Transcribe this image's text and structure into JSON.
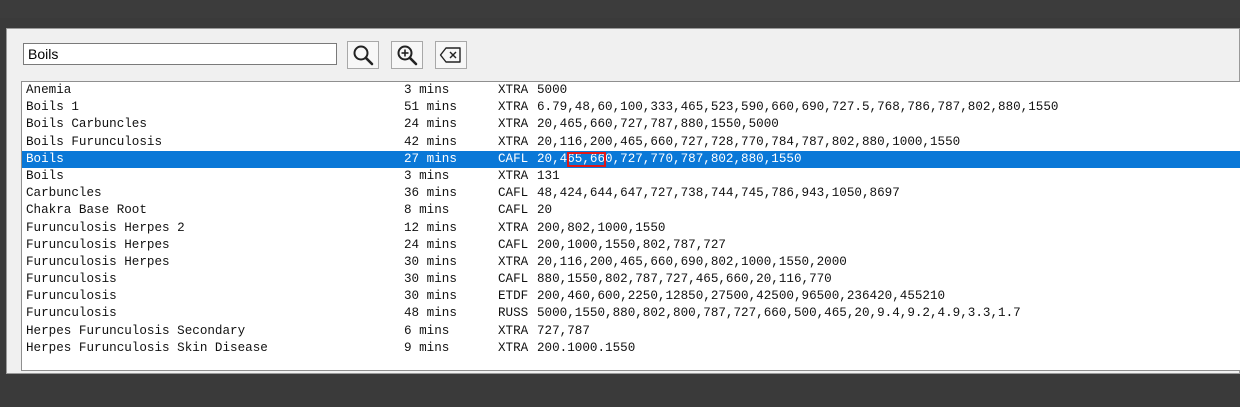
{
  "search": {
    "value": "Boils"
  },
  "buttons": {
    "search": "search-icon",
    "zoom_in": "zoom-in-icon",
    "clear": "clear-icon"
  },
  "rows": [
    {
      "name": "Anemia",
      "time": "3 mins",
      "code": "XTRA",
      "freq": "5000"
    },
    {
      "name": "Boils 1",
      "time": "51 mins",
      "code": "XTRA",
      "freq": "6.79,48,60,100,333,465,523,590,660,690,727.5,768,786,787,802,880,1550"
    },
    {
      "name": "Boils Carbuncles",
      "time": "24 mins",
      "code": "XTRA",
      "freq": "20,465,660,727,787,880,1550,5000"
    },
    {
      "name": "Boils Furunculosis",
      "time": "42 mins",
      "code": "XTRA",
      "freq": "20,116,200,465,660,727,728,770,784,787,802,880,1000,1550"
    },
    {
      "name": "Boils",
      "time": "27 mins",
      "code": "CAFL",
      "freq": "20,465,660,727,770,787,802,880,1550",
      "selected": true
    },
    {
      "name": "Boils",
      "time": "3 mins",
      "code": "XTRA",
      "freq": "131"
    },
    {
      "name": "Carbuncles",
      "time": "36 mins",
      "code": "CAFL",
      "freq": "48,424,644,647,727,738,744,745,786,943,1050,8697"
    },
    {
      "name": "Chakra Base Root",
      "time": "8 mins",
      "code": "CAFL",
      "freq": "20"
    },
    {
      "name": "Furunculosis Herpes 2",
      "time": "12 mins",
      "code": "XTRA",
      "freq": "200,802,1000,1550"
    },
    {
      "name": "Furunculosis Herpes",
      "time": "24 mins",
      "code": "CAFL",
      "freq": "200,1000,1550,802,787,727"
    },
    {
      "name": "Furunculosis Herpes",
      "time": "30 mins",
      "code": "XTRA",
      "freq": "20,116,200,465,660,690,802,1000,1550,2000"
    },
    {
      "name": "Furunculosis",
      "time": "30 mins",
      "code": "CAFL",
      "freq": "880,1550,802,787,727,465,660,20,116,770"
    },
    {
      "name": "Furunculosis",
      "time": "30 mins",
      "code": "ETDF",
      "freq": "200,460,600,2250,12850,27500,42500,96500,236420,455210"
    },
    {
      "name": "Furunculosis",
      "time": "48 mins",
      "code": "RUSS",
      "freq": "5000,1550,880,802,800,787,727,660,500,465,20,9.4,9.2,4.9,3.3,1.7"
    },
    {
      "name": "Herpes Furunculosis Secondary",
      "time": "6 mins",
      "code": "XTRA",
      "freq": "727,787"
    },
    {
      "name": "Herpes Furunculosis Skin Disease",
      "time": "9 mins",
      "code": "XTRA",
      "freq": "200.1000.1550"
    }
  ]
}
